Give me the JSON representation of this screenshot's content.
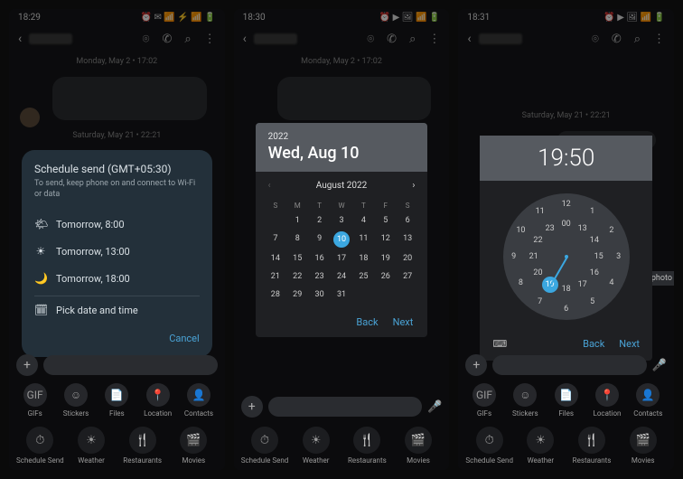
{
  "phone1": {
    "time": "18:29",
    "status_icons": "⏰ ✉ 📶 ⚡ 📶 🔋",
    "date1": "Monday, May 2 • 17:02",
    "date2": "Saturday, May 21 • 22:21",
    "dialog": {
      "title": "Schedule send (GMT+05:30)",
      "subtitle": "To send, keep phone on and connect to Wi‑Fi or data",
      "options": [
        {
          "icon": "🌤",
          "label": "Tomorrow, 8:00"
        },
        {
          "icon": "☀",
          "label": "Tomorrow, 13:00"
        },
        {
          "icon": "🌙",
          "label": "Tomorrow, 18:00"
        }
      ],
      "pick_label": "Pick date and time",
      "cancel": "Cancel"
    },
    "attachments": [
      "GIFs",
      "Stickers",
      "Files",
      "Location",
      "Contacts"
    ],
    "shortcuts": [
      {
        "icon": "⏱",
        "label": "Schedule Send"
      },
      {
        "icon": "☀",
        "label": "Weather"
      },
      {
        "icon": "🍴",
        "label": "Restaurants"
      },
      {
        "icon": "🎬",
        "label": "Movies"
      }
    ]
  },
  "phone2": {
    "time": "18:30",
    "status_icons": "⏰ ▶ 🖼 📶 🔋",
    "date1": "Monday, May 2 • 17:02",
    "calendar": {
      "year": "2022",
      "headline": "Wed, Aug 10",
      "month_label": "August 2022",
      "dow": [
        "S",
        "M",
        "T",
        "W",
        "T",
        "F",
        "S"
      ],
      "selected_day": "10",
      "weeks": [
        [
          "",
          "1",
          "2",
          "3",
          "4",
          "5",
          "6"
        ],
        [
          "7",
          "8",
          "9",
          "10",
          "11",
          "12",
          "13"
        ],
        [
          "14",
          "15",
          "16",
          "17",
          "18",
          "19",
          "20"
        ],
        [
          "21",
          "22",
          "23",
          "24",
          "25",
          "26",
          "27"
        ],
        [
          "28",
          "29",
          "30",
          "31",
          "",
          "",
          ""
        ]
      ],
      "back": "Back",
      "next": "Next"
    }
  },
  "phone3": {
    "time": "18:31",
    "status_icons": "⏰ ▶ 🖼 📶 🔋",
    "date1": "Saturday, May 21 • 22:21",
    "clock": {
      "display": "19:50",
      "outer": [
        "12",
        "1",
        "2",
        "3",
        "4",
        "5",
        "6",
        "7",
        "8",
        "9",
        "10",
        "11"
      ],
      "inner": [
        "00",
        "13",
        "14",
        "15",
        "16",
        "17",
        "18",
        "19",
        "20",
        "21",
        "22",
        "23"
      ],
      "selected": "19",
      "back": "Back",
      "next": "Next"
    },
    "photo_chip": "photo"
  }
}
